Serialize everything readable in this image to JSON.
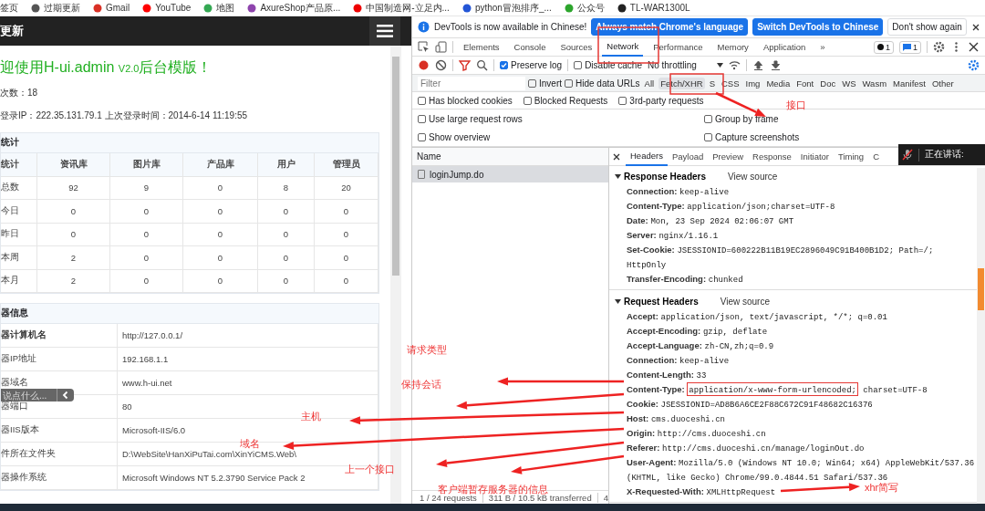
{
  "bookmarks": [
    "签页",
    "过期更新",
    "Gmail",
    "YouTube",
    "地图",
    "AxureShop产品原...",
    "中国制造网-立足内...",
    "python冒泡排序_...",
    "公众号",
    "TL-WAR1300L"
  ],
  "page": {
    "header_title": "更新",
    "welcome": {
      "before": "迎使用H-ui.admin ",
      "version": "V2.0",
      "after": "后台模版！"
    },
    "login_count": "次数：18",
    "last_login": "登录IP：222.35.131.79.1 上次登录时间：2014-6-14 11:19:55",
    "stats": {
      "title": "统计",
      "columns": [
        "统计",
        "资讯库",
        "图片库",
        "产品库",
        "用户",
        "管理员"
      ],
      "rows": [
        [
          "总数",
          "92",
          "9",
          "0",
          "8",
          "20"
        ],
        [
          "今日",
          "0",
          "0",
          "0",
          "0",
          "0"
        ],
        [
          "昨日",
          "0",
          "0",
          "0",
          "0",
          "0"
        ],
        [
          "本周",
          "2",
          "0",
          "0",
          "0",
          "0"
        ],
        [
          "本月",
          "2",
          "0",
          "0",
          "0",
          "0"
        ]
      ]
    },
    "server_info": {
      "title": "器信息",
      "rows": [
        [
          "器计算机名",
          "http://127.0.0.1/"
        ],
        [
          "器IP地址",
          "192.168.1.1"
        ],
        [
          "器域名",
          "www.h-ui.net"
        ],
        [
          "器端口",
          "80"
        ],
        [
          "器IIS版本",
          "Microsoft-IIS/6.0"
        ],
        [
          "件所在文件夹",
          "D:\\WebSite\\HanXiPuTai.com\\XinYiCMS.Web\\"
        ],
        [
          "器操作系统",
          "Microsoft Windows NT 5.2.3790 Service Pack 2"
        ]
      ]
    },
    "chat_widget": {
      "placeholder": "说点什么..."
    }
  },
  "devtools": {
    "infobar": {
      "message": "DevTools is now available in Chinese!",
      "buttons": [
        "Always match Chrome's language",
        "Switch DevTools to Chinese",
        "Don't show again"
      ]
    },
    "tabs": [
      {
        "label": "Elements",
        "selected": false
      },
      {
        "label": "Console",
        "selected": false
      },
      {
        "label": "Sources",
        "selected": false
      },
      {
        "label": "Network",
        "selected": true
      },
      {
        "label": "Performance",
        "selected": false
      },
      {
        "label": "Memory",
        "selected": false
      },
      {
        "label": "Application",
        "selected": false
      }
    ],
    "more_tabs": "»",
    "badges": [
      "1",
      "1"
    ],
    "preserve_log": {
      "label": "Preserve log",
      "checked": true
    },
    "disable_cache": {
      "label": "Disable cache",
      "checked": false
    },
    "throttling": "No throttling",
    "filter": {
      "placeholder": "Filter"
    },
    "filter_options": [
      {
        "label": "Invert",
        "checked": false
      },
      {
        "label": "Hide data URLs",
        "checked": false
      }
    ],
    "types": [
      {
        "label": "All",
        "selected": false
      },
      {
        "label": "Fetch/XHR",
        "selected": true
      },
      {
        "label": "S",
        "selected": false
      },
      {
        "label": "CSS",
        "selected": false
      },
      {
        "label": "Img",
        "selected": false
      },
      {
        "label": "Media",
        "selected": false
      },
      {
        "label": "Font",
        "selected": false
      },
      {
        "label": "Doc",
        "selected": false
      },
      {
        "label": "WS",
        "selected": false
      },
      {
        "label": "Wasm",
        "selected": false
      },
      {
        "label": "Manifest",
        "selected": false
      },
      {
        "label": "Other",
        "selected": false
      }
    ],
    "blocked_options": [
      {
        "label": "Has blocked cookies",
        "checked": false
      },
      {
        "label": "Blocked Requests",
        "checked": false
      },
      {
        "label": "3rd-party requests",
        "checked": false
      }
    ],
    "settings": [
      {
        "label": "Use large request rows",
        "checked": false
      },
      {
        "label": "Group by frame",
        "checked": false
      },
      {
        "label": "Show overview",
        "checked": false
      },
      {
        "label": "Capture screenshots",
        "checked": false
      }
    ],
    "requests": {
      "header": "Name",
      "items": [
        {
          "name": "loginJump.do",
          "selected": true
        }
      ]
    },
    "status": [
      "1 / 24 requests",
      "311 B / 10.5 kB transferred",
      "4"
    ],
    "detail_tabs": [
      {
        "label": "Headers",
        "selected": true
      },
      {
        "label": "Payload",
        "selected": false
      },
      {
        "label": "Preview",
        "selected": false
      },
      {
        "label": "Response",
        "selected": false
      },
      {
        "label": "Initiator",
        "selected": false
      },
      {
        "label": "Timing",
        "selected": false
      },
      {
        "label": "C",
        "selected": false
      }
    ],
    "sections": [
      {
        "title": "Response Headers",
        "link": "View source",
        "expanded": true,
        "headers": [
          {
            "name": "Connection:",
            "value": "keep-alive"
          },
          {
            "name": "Content-Type:",
            "value": "application/json;charset=UTF-8"
          },
          {
            "name": "Date:",
            "value": "Mon, 23 Sep 2024 02:06:07 GMT"
          },
          {
            "name": "Server:",
            "value": "nginx/1.16.1"
          },
          {
            "name": "Set-Cookie:",
            "value": "JSESSIONID=600222B11B19EC2896049C91B400B1D2; Path=/; HttpOnly"
          },
          {
            "name": "Transfer-Encoding:",
            "value": "chunked"
          }
        ]
      },
      {
        "title": "Request Headers",
        "link": "View source",
        "expanded": true,
        "headers": [
          {
            "name": "Accept:",
            "value": "application/json, text/javascript, */*; q=0.01"
          },
          {
            "name": "Accept-Encoding:",
            "value": "gzip, deflate"
          },
          {
            "name": "Accept-Language:",
            "value": "zh-CN,zh;q=0.9"
          },
          {
            "name": "Connection:",
            "value": "keep-alive"
          },
          {
            "name": "Content-Length:",
            "value": "33"
          },
          {
            "name": "Content-Type:",
            "value": "application/x-www-form-urlencoded;",
            "value_rest": " charset=UTF-8",
            "highlighted": true
          },
          {
            "name": "Cookie:",
            "value": "JSESSIONID=AD8B6A6CE2F88C672C91F48682C16376"
          },
          {
            "name": "Host:",
            "value": "cms.duoceshi.cn"
          },
          {
            "name": "Origin:",
            "value": "http://cms.duoceshi.cn"
          },
          {
            "name": "Referer:",
            "value": "http://cms.duoceshi.cn/manage/loginOut.do"
          },
          {
            "name": "User-Agent:",
            "value": "Mozilla/5.0 (Windows NT 10.0; Win64; x64) AppleWebKit/537.36 (KHTML, like Gecko) Chrome/99.0.4844.51 Safari/537.36"
          },
          {
            "name": "X-Requested-With:",
            "value": "XMLHttpRequest"
          }
        ]
      }
    ]
  },
  "speaking_overlay": "正在讲话:",
  "annotations": [
    "接口",
    "请求类型",
    "保持会话",
    "主机",
    "域名",
    "上一个接口",
    "客户端暂存服务器的信息",
    "xhr简写"
  ]
}
